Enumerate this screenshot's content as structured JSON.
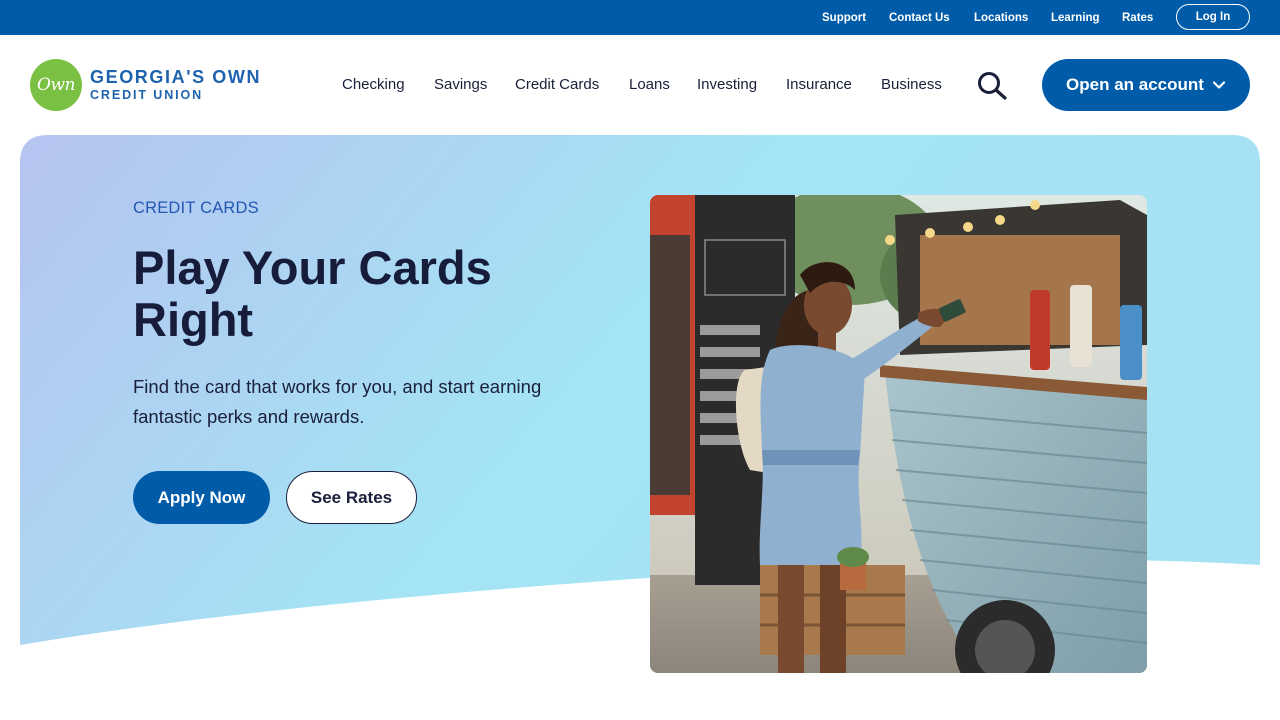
{
  "utility_nav": {
    "links": [
      "Support",
      "Contact Us",
      "Locations",
      "Learning",
      "Rates"
    ],
    "login_label": "Log In"
  },
  "brand": {
    "logo_mark": "Own",
    "name": "GEORGIA'S OWN",
    "sub": "CREDIT UNION"
  },
  "main_nav": {
    "items": [
      "Checking",
      "Savings",
      "Credit Cards",
      "Loans",
      "Investing",
      "Insurance",
      "Business"
    ],
    "search_icon": "search-icon",
    "cta_label": "Open an account"
  },
  "hero": {
    "eyebrow": "CREDIT CARDS",
    "headline": "Play Your Cards Right",
    "subtext": "Find the card that works for you, and start earning fantastic perks and rewards.",
    "primary_button": "Apply Now",
    "secondary_button": "See Rates",
    "photo_icon": "woman-at-food-truck-photo"
  },
  "colors": {
    "brand_blue": "#005ca9",
    "logo_green": "#7ac143",
    "eyebrow_blue": "#2456b3",
    "gradient_start": "#b6c3f0",
    "gradient_end": "#a4e4f5"
  }
}
